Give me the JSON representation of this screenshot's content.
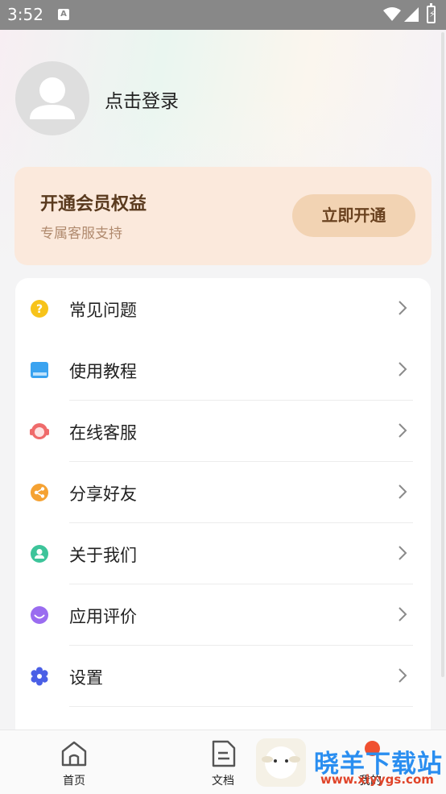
{
  "status_bar": {
    "time": "3:52",
    "notification_glyph": "A"
  },
  "header": {
    "login_label": "点击登录"
  },
  "vip_card": {
    "title": "开通会员权益",
    "subtitle": "专属客服支持",
    "button_label": "立即开通"
  },
  "menu": {
    "items": [
      {
        "label": "常见问题",
        "icon": "question-icon",
        "color": "#f7c31a"
      },
      {
        "label": "使用教程",
        "icon": "book-icon",
        "color": "#3aa3f0"
      },
      {
        "label": "在线客服",
        "icon": "headset-icon",
        "color": "#ef6b6b"
      },
      {
        "label": "分享好友",
        "icon": "share-icon",
        "color": "#f5a233"
      },
      {
        "label": "关于我们",
        "icon": "people-icon",
        "color": "#3dc49a"
      },
      {
        "label": "应用评价",
        "icon": "smile-icon",
        "color": "#9a6cf0"
      },
      {
        "label": "设置",
        "icon": "gear-icon",
        "color": "#4a5fe6"
      }
    ]
  },
  "tab_bar": {
    "tabs": [
      {
        "label": "首页",
        "icon": "home-icon"
      },
      {
        "label": "文档",
        "icon": "document-icon"
      },
      {
        "label": "我的",
        "icon": "profile-icon"
      }
    ]
  },
  "watermark": {
    "text": "晓羊下载站",
    "url": "www.xiyygs.com"
  }
}
